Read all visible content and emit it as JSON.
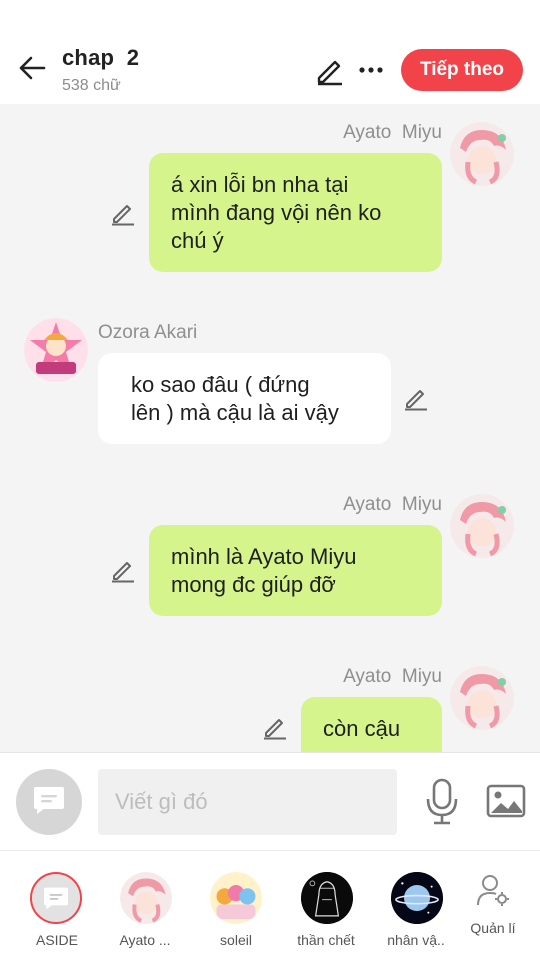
{
  "header": {
    "title": "chap  2",
    "subtitle": "538 chữ",
    "next_label": "Tiếp theo",
    "accent_color": "#f2434a"
  },
  "messages": [
    {
      "sender": "Ayato  Miyu",
      "side": "right",
      "text_lines": [
        "á xin lỗi bn nha tại",
        "mình đang vội nên ko",
        "chú ý"
      ]
    },
    {
      "sender": "Ozora Akari",
      "side": "left",
      "text_lines": [
        "ko sao đâu ( đứng",
        "lên ) mà cậu là ai vậy"
      ]
    },
    {
      "sender": "Ayato  Miyu",
      "side": "right",
      "text_lines": [
        "mình là Ayato Miyu",
        "mong đc giúp đỡ"
      ]
    },
    {
      "sender": "Ayato  Miyu",
      "side": "right",
      "text_lines": [
        "còn cậu"
      ]
    }
  ],
  "composer": {
    "placeholder": "Viết gì đó",
    "input_bg": "#f0f0f0"
  },
  "bottom_bar": {
    "items": [
      {
        "label": "ASIDE",
        "icon": "aside-icon",
        "selected": true
      },
      {
        "label": "Ayato ...",
        "icon": "avatar-ayato"
      },
      {
        "label": "soleil",
        "icon": "avatar-soleil"
      },
      {
        "label": "thần chết",
        "icon": "avatar-than-chet"
      },
      {
        "label": "nhân vậ..",
        "icon": "avatar-nhan-vat"
      },
      {
        "label": "Quản lí",
        "icon": "manage-user-icon"
      }
    ]
  },
  "colors": {
    "my_bubble": "#d5f58c",
    "their_bubble": "#ffffff",
    "background": "#f4f4f4"
  }
}
